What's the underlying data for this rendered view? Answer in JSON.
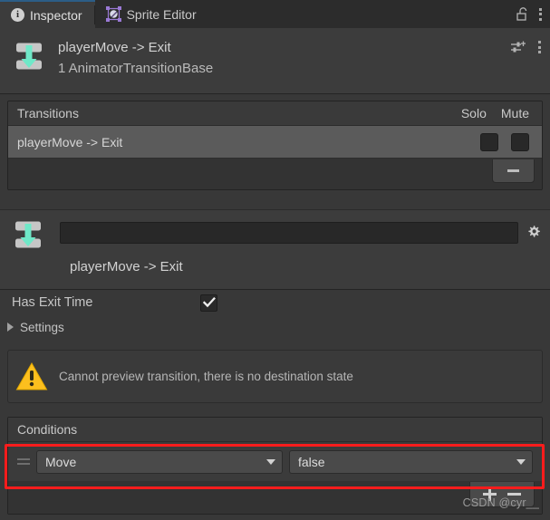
{
  "window": {
    "tabs": [
      {
        "label": "Inspector",
        "icon": "info-icon",
        "active": true
      },
      {
        "label": "Sprite Editor",
        "icon": "sprite-editor-icon",
        "active": false
      }
    ],
    "lock_icon": "unlocked-padlock-icon",
    "menu_icon": "kebab-menu-icon"
  },
  "object_header": {
    "icon": "animator-transition-icon",
    "title": "playerMove -> Exit",
    "subtitle": "1 AnimatorTransitionBase",
    "preset_icon": "preset-sliders-icon",
    "menu_icon": "kebab-menu-icon"
  },
  "transitions": {
    "header_title": "Transitions",
    "col_solo": "Solo",
    "col_mute": "Mute",
    "rows": [
      {
        "label": "playerMove -> Exit",
        "solo": false,
        "mute": false,
        "selected": true
      }
    ],
    "remove_button": "-"
  },
  "transition_detail": {
    "icon": "animator-transition-icon",
    "name_value": "",
    "name_placeholder": "",
    "settings_icon": "gear-icon",
    "caption": "playerMove -> Exit"
  },
  "properties": {
    "has_exit_time_label": "Has Exit Time",
    "has_exit_time_checked": true,
    "settings_label": "Settings",
    "settings_expanded": false
  },
  "warning": {
    "icon": "warning-triangle-icon",
    "message": "Cannot preview transition, there is no destination state"
  },
  "conditions": {
    "header_title": "Conditions",
    "rows": [
      {
        "drag_handle": "drag-handle-icon",
        "parameter": "Move",
        "value": "false"
      }
    ],
    "add_button": "+",
    "remove_button": "-"
  },
  "annotation": {
    "highlight_color": "#fc1c1c"
  },
  "watermark": "CSDN @cyr__"
}
